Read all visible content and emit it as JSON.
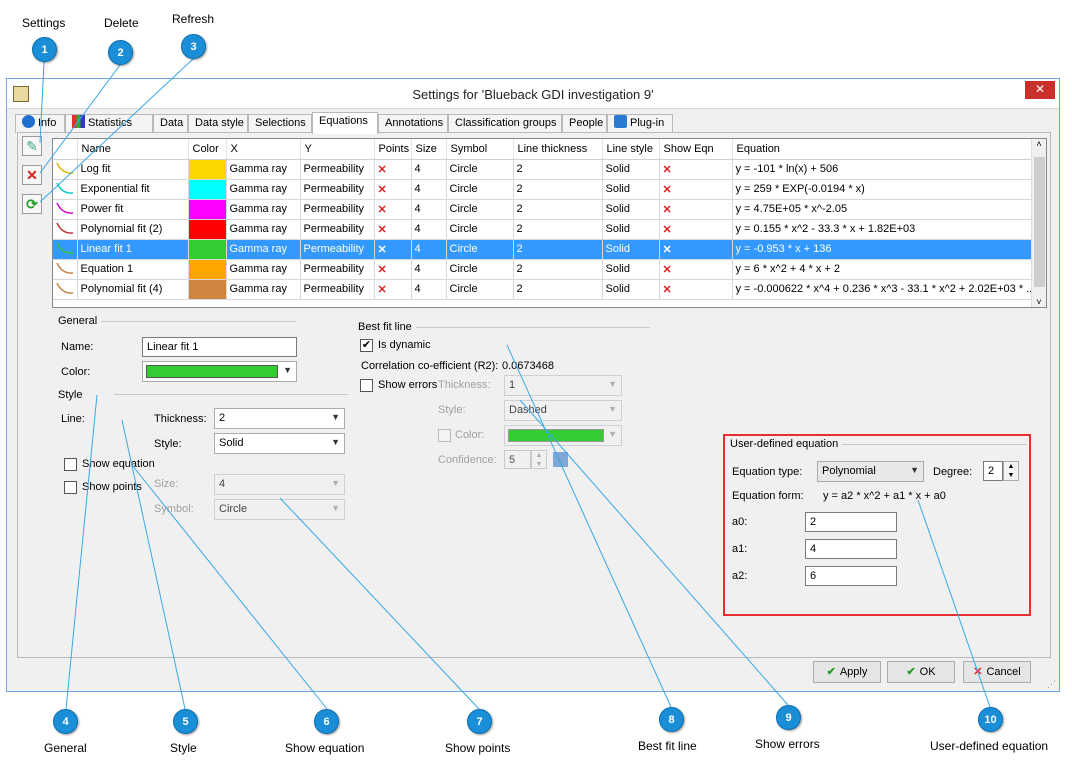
{
  "callouts": [
    {
      "num": "1",
      "label": "Settings"
    },
    {
      "num": "2",
      "label": "Delete"
    },
    {
      "num": "3",
      "label": "Refresh"
    },
    {
      "num": "4",
      "label": "General"
    },
    {
      "num": "5",
      "label": "Style"
    },
    {
      "num": "6",
      "label": "Show equation"
    },
    {
      "num": "7",
      "label": "Show points"
    },
    {
      "num": "8",
      "label": "Best fit line"
    },
    {
      "num": "9",
      "label": "Show errors"
    },
    {
      "num": "10",
      "label": "User-defined equation"
    }
  ],
  "window": {
    "title": "Settings for 'Blueback GDI investigation 9'",
    "close_glyph": "✕"
  },
  "tabs": [
    "Info",
    "Statistics",
    "Data",
    "Data style",
    "Selections",
    "Equations",
    "Annotations",
    "Classification groups",
    "People",
    "Plug-in"
  ],
  "active_tab": "Equations",
  "side_buttons": {
    "settings_glyph": "✎",
    "delete_glyph": "✕",
    "refresh_glyph": "⟳"
  },
  "grid": {
    "headers": [
      "Name",
      "Color",
      "X",
      "Y",
      "Points",
      "Size",
      "Symbol",
      "Line thickness",
      "Line style",
      "Show Eqn",
      "Equation"
    ],
    "x_glyph": "✕",
    "rows": [
      {
        "name": "Log fit",
        "color": "#ffd700",
        "curve": "#e0b000",
        "x": "Gamma ray",
        "y": "Permeability",
        "size": "4",
        "symbol": "Circle",
        "thickness": "2",
        "style": "Solid",
        "equation": "y = -101 * ln(x) + 506"
      },
      {
        "name": "Exponential fit",
        "color": "#00ffff",
        "curve": "#00c8c8",
        "x": "Gamma ray",
        "y": "Permeability",
        "size": "4",
        "symbol": "Circle",
        "thickness": "2",
        "style": "Solid",
        "equation": "y = 259 * EXP(-0.0194 * x)"
      },
      {
        "name": "Power fit",
        "color": "#ff00ff",
        "curve": "#d000d0",
        "x": "Gamma ray",
        "y": "Permeability",
        "size": "4",
        "symbol": "Circle",
        "thickness": "2",
        "style": "Solid",
        "equation": "y = 4.75E+05 * x^-2.05"
      },
      {
        "name": "Polynomial fit (2)",
        "color": "#ff0000",
        "curve": "#c03030",
        "x": "Gamma ray",
        "y": "Permeability",
        "size": "4",
        "symbol": "Circle",
        "thickness": "2",
        "style": "Solid",
        "equation": "y = 0.155 * x^2 - 33.3 * x + 1.82E+03"
      },
      {
        "name": "Linear fit 1",
        "color": "#33cc33",
        "curve": "#33cc33",
        "x": "Gamma ray",
        "y": "Permeability",
        "size": "4",
        "symbol": "Circle",
        "thickness": "2",
        "style": "Solid",
        "equation": "y = -0.953 * x + 136"
      },
      {
        "name": "Equation 1",
        "color": "#ffa500",
        "curve": "#c08040",
        "x": "Gamma ray",
        "y": "Permeability",
        "size": "4",
        "symbol": "Circle",
        "thickness": "2",
        "style": "Solid",
        "equation": "y = 6 * x^2 + 4 * x + 2"
      },
      {
        "name": "Polynomial fit (4)",
        "color": "#cd853f",
        "curve": "#c08040",
        "x": "Gamma ray",
        "y": "Permeability",
        "size": "4",
        "symbol": "Circle",
        "thickness": "2",
        "style": "Solid",
        "equation": "y = -0.000622 * x^4 + 0.236 * x^3 - 33.1 * x^2 + 2.02E+03 * ..."
      }
    ],
    "selected_index": 4,
    "scroll_up": "˄",
    "scroll_down": "˅"
  },
  "general": {
    "group_title": "General",
    "name_label": "Name:",
    "name_value": "Linear fit 1",
    "color_label": "Color:",
    "color_value": "#33cc33",
    "style_title": "Style",
    "line_label": "Line:",
    "thickness_label": "Thickness:",
    "thickness_value": "2",
    "style_label": "Style:",
    "style_value": "Solid",
    "show_equation_label": "Show equation",
    "show_points_label": "Show points",
    "size_label": "Size:",
    "size_value": "4",
    "symbol_label": "Symbol:",
    "symbol_value": "Circle"
  },
  "best_fit": {
    "group_title": "Best fit line",
    "is_dynamic_label": "Is dynamic",
    "is_dynamic_checked": "✔",
    "r2_label": "Correlation co-efficient (R2):",
    "r2_value": "0.0673468",
    "show_errors_label": "Show errors",
    "thickness_label": "Thickness:",
    "thickness_value": "1",
    "style_label": "Style:",
    "style_value": "Dashed",
    "color_label": "Color:",
    "color_value": "#33cc33",
    "confidence_label": "Confidence:",
    "confidence_value": "5"
  },
  "user_defined": {
    "group_title": "User-defined equation",
    "type_label": "Equation type:",
    "type_value": "Polynomial",
    "degree_label": "Degree:",
    "degree_value": "2",
    "form_label": "Equation form:",
    "form_value": "y = a2 * x^2 + a1 * x + a0",
    "a0_label": "a0:",
    "a0_value": "2",
    "a1_label": "a1:",
    "a1_value": "4",
    "a2_label": "a2:",
    "a2_value": "6"
  },
  "buttons": {
    "apply": "Apply",
    "ok": "OK",
    "cancel": "Cancel",
    "check_glyph": "✔",
    "cancel_glyph": "✕"
  },
  "colors": {
    "accent": "#3399ff",
    "callout": "#1a8fd8",
    "highlight_box": "#e53030"
  }
}
